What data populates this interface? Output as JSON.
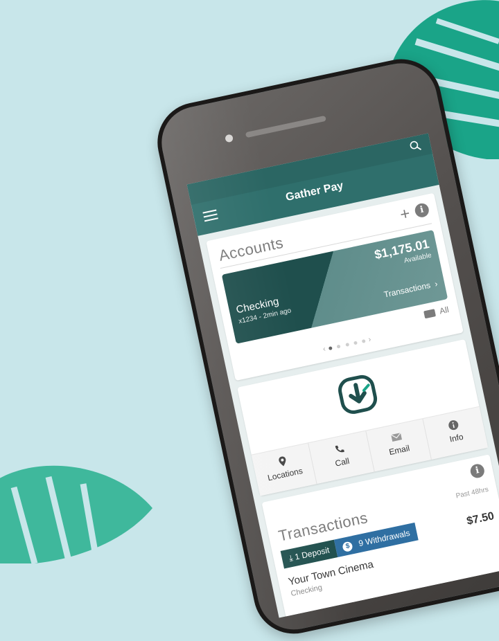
{
  "app": {
    "title": "Gather Pay"
  },
  "accounts": {
    "title": "Accounts",
    "account": {
      "name": "Checking",
      "subtitle": "x1234 - 2min ago",
      "balance": "$1,175.01",
      "available_label": "Available",
      "transactions_link": "Transactions"
    },
    "all_label": "All",
    "pager": {
      "pages": 5,
      "active": 1
    }
  },
  "contact": {
    "actions": [
      {
        "label": "Locations",
        "icon": "location-pin-icon"
      },
      {
        "label": "Call",
        "icon": "phone-icon"
      },
      {
        "label": "Email",
        "icon": "envelope-icon"
      },
      {
        "label": "Info",
        "icon": "info-icon"
      }
    ]
  },
  "transactions": {
    "title": "Transactions",
    "range": "Past 48hrs",
    "deposits": "1 Deposit",
    "withdrawals": "9 Withdrawals",
    "items": [
      {
        "merchant": "Your Town Cinema",
        "account": "Checking",
        "amount": "$7.50"
      }
    ]
  },
  "colors": {
    "primary": "#1f4f4d",
    "appbar": "#2f6f6c",
    "withdrawal": "#2f6fa2",
    "background": "#c8e6ea",
    "leaf": "#1aa488"
  }
}
